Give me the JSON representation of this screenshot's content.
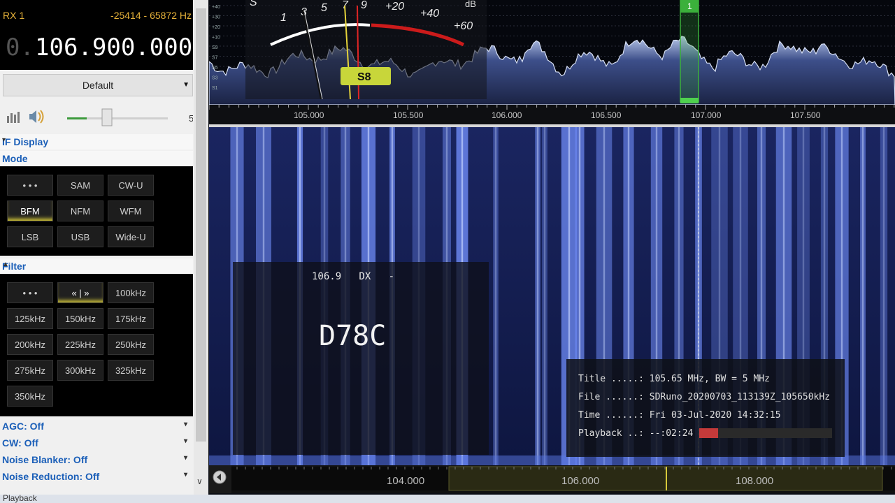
{
  "receiver": {
    "label": "RX 1",
    "range": "-25414 - 65872 Hz",
    "freq_dim": "0.",
    "frequency": "106.900.000",
    "preset": "Default"
  },
  "volume": {
    "level": 0.32,
    "right_label": "5"
  },
  "sections": {
    "if_display": "IF Display",
    "mode": "Mode",
    "filter": "Filter"
  },
  "mode_buttons": [
    {
      "label": "• • •",
      "active": false
    },
    {
      "label": "SAM",
      "active": false
    },
    {
      "label": "CW-U",
      "active": false
    },
    {
      "label": "BFM",
      "active": true
    },
    {
      "label": "NFM",
      "active": false
    },
    {
      "label": "WFM",
      "active": false
    },
    {
      "label": "LSB",
      "active": false
    },
    {
      "label": "USB",
      "active": false
    },
    {
      "label": "Wide-U",
      "active": false
    }
  ],
  "filter_buttons": [
    {
      "label": "• • •",
      "active": false
    },
    {
      "label": "« | »",
      "active": true
    },
    {
      "label": "100kHz",
      "active": false
    },
    {
      "label": "125kHz",
      "active": false
    },
    {
      "label": "150kHz",
      "active": false
    },
    {
      "label": "175kHz",
      "active": false
    },
    {
      "label": "200kHz",
      "active": false
    },
    {
      "label": "225kHz",
      "active": false
    },
    {
      "label": "250kHz",
      "active": false
    },
    {
      "label": "275kHz",
      "active": false
    },
    {
      "label": "300kHz",
      "active": false
    },
    {
      "label": "325kHz",
      "active": false
    },
    {
      "label": "350kHz",
      "active": false
    }
  ],
  "footer_items": [
    "AGC: Off",
    "CW: Off",
    "Noise Blanker: Off",
    "Noise Reduction: Off"
  ],
  "smeter": {
    "scale_left": [
      "S",
      "1",
      "3",
      "5",
      "7",
      "9"
    ],
    "scale_right": [
      "+20",
      "+40",
      "+60"
    ],
    "unit": "dB",
    "reading": "S8",
    "db_ticks": [
      "+40",
      "+30",
      "+20",
      "+10",
      "S9",
      "S7",
      "S5",
      "S3",
      "S1"
    ]
  },
  "vfo_marker": "1",
  "spectrum_axis": [
    "105.000",
    "105.500",
    "106.000",
    "106.500",
    "107.000",
    "107.500"
  ],
  "overview_axis": [
    "104.000",
    "106.000",
    "108.000"
  ],
  "rds": {
    "line": "106.9   DX   -",
    "ps": "D78C"
  },
  "fileinfo": {
    "title": "Title .....: 105.65 MHz, BW = 5 MHz",
    "file": "File ......: SDRuno_20200703_113139Z_105650kHz",
    "time": "Time ......: Fri 03-Jul-2020 14:32:15",
    "playback": "Playback ..: --:02:24",
    "progress": 0.14
  },
  "status": "Playback",
  "colors": {
    "accent_yellow": "#d6c93a",
    "label_blue": "#1b5fb8",
    "waterfall_blue": "#5a78e6",
    "vfo_green": "#3bb03b",
    "meter_red": "#cc1b1b"
  }
}
